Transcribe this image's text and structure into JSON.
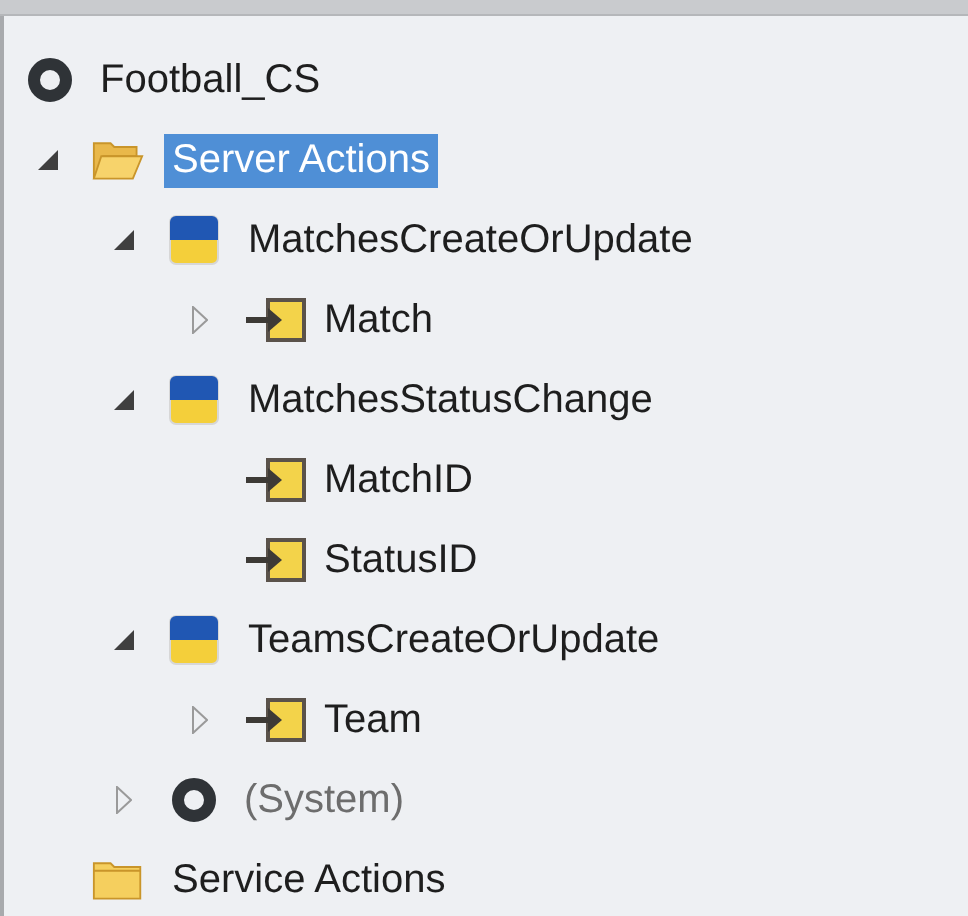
{
  "tree": [
    {
      "label": "Football_CS",
      "kind": "module",
      "selected": false,
      "children": [
        {
          "label": "Server Actions",
          "kind": "folder",
          "expanded": true,
          "selected": true,
          "children": [
            {
              "label": "MatchesCreateOrUpdate",
              "kind": "action",
              "expanded": true,
              "selected": false,
              "children": [
                {
                  "label": "Match",
                  "kind": "parameter",
                  "expanded": false,
                  "selected": false
                }
              ]
            },
            {
              "label": "MatchesStatusChange",
              "kind": "action",
              "expanded": true,
              "selected": false,
              "children": [
                {
                  "label": "MatchID",
                  "kind": "parameter",
                  "selected": false
                },
                {
                  "label": "StatusID",
                  "kind": "parameter",
                  "selected": false
                }
              ]
            },
            {
              "label": "TeamsCreateOrUpdate",
              "kind": "action",
              "expanded": true,
              "selected": false,
              "children": [
                {
                  "label": "Team",
                  "kind": "parameter",
                  "expanded": false,
                  "selected": false
                }
              ]
            },
            {
              "label": "(System)",
              "kind": "module",
              "expanded": false,
              "selected": false,
              "dimmed": true
            }
          ]
        },
        {
          "label": "Service Actions",
          "kind": "folder",
          "selected": false
        }
      ]
    }
  ]
}
